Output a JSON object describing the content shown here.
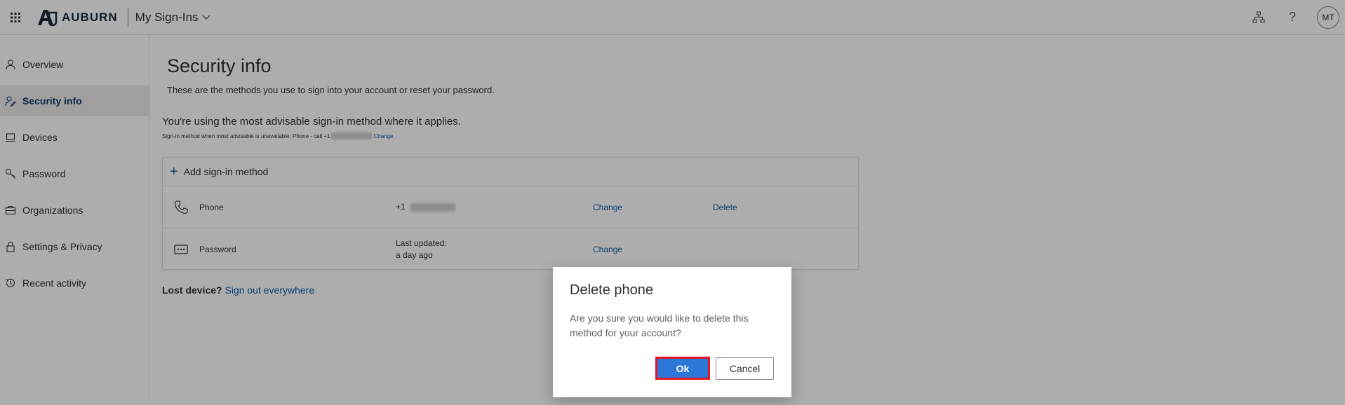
{
  "header": {
    "brand": "AUBURN",
    "app_title": "My Sign-Ins",
    "avatar_initials": "MT",
    "icons": [
      "app-launcher-icon",
      "org-chart-icon",
      "help-icon"
    ]
  },
  "sidebar": {
    "items": [
      {
        "label": "Overview",
        "icon": "person-icon"
      },
      {
        "label": "Security info",
        "icon": "security-person-icon"
      },
      {
        "label": "Devices",
        "icon": "laptop-icon"
      },
      {
        "label": "Password",
        "icon": "key-icon"
      },
      {
        "label": "Organizations",
        "icon": "briefcase-icon"
      },
      {
        "label": "Settings & Privacy",
        "icon": "lock-icon"
      },
      {
        "label": "Recent activity",
        "icon": "history-icon"
      }
    ],
    "active": "Security info"
  },
  "main": {
    "title": "Security info",
    "subtitle": "These are the methods you use to sign into your account or reset your password.",
    "advisable": "You're using the most advisable sign-in method where it applies.",
    "advisable_small": "Sign-in method when most advisable is unavailable: Phone - call +1",
    "advisable_change": "Change",
    "add_method": "Add sign-in method",
    "methods": [
      {
        "name": "Phone",
        "detail": "+1",
        "change": "Change",
        "delete": "Delete"
      },
      {
        "name": "Password",
        "detail_line1": "Last updated:",
        "detail_line2": "a day ago",
        "change": "Change"
      }
    ],
    "lost_label": "Lost device?",
    "lost_link": "Sign out everywhere"
  },
  "dialog": {
    "title": "Delete phone",
    "body": "Are you sure you would like to delete this method for your account?",
    "ok": "Ok",
    "cancel": "Cancel"
  },
  "colors": {
    "accent": "#0f5ea8",
    "primary_button": "#2f76d9",
    "highlight_border": "#e3161d"
  }
}
